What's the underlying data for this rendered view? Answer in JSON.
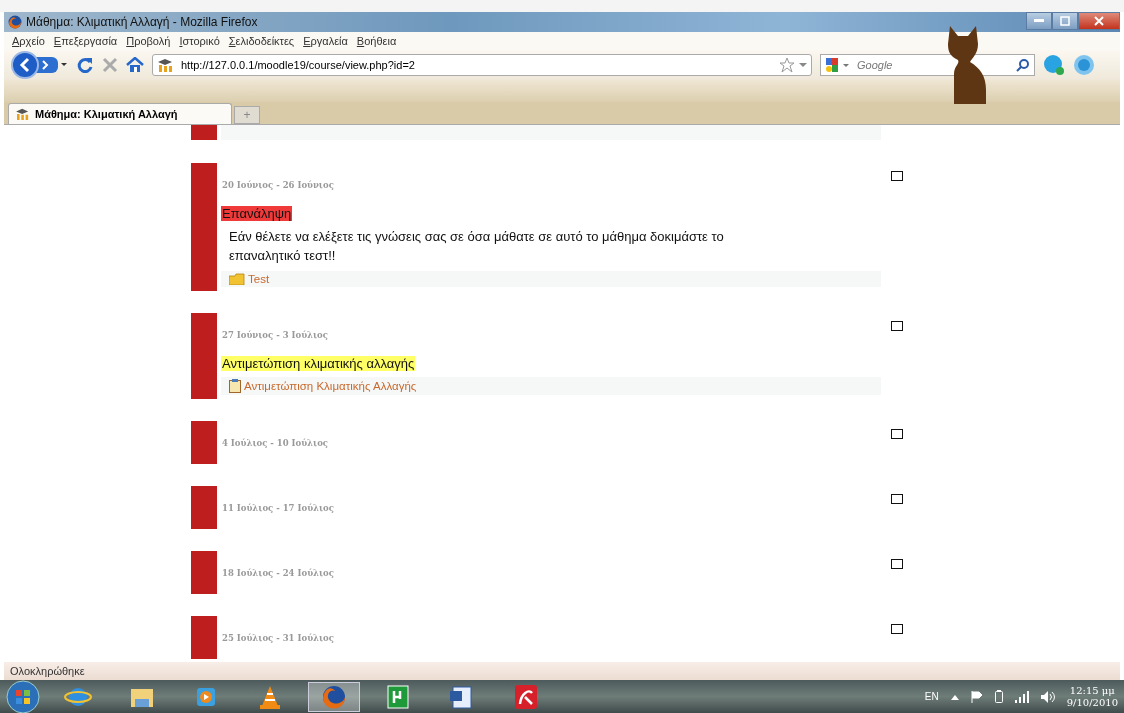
{
  "window": {
    "title": "Μάθημα: Κλιματική Αλλαγή - Mozilla Firefox"
  },
  "menu": [
    "Αρχείο",
    "Επεξεργασία",
    "Προβολή",
    "Ιστορικό",
    "Σελιδοδείκτες",
    "Εργαλεία",
    "Βοήθεια"
  ],
  "address_bar": {
    "value": "http://127.0.0.1/moodle19/course/view.php?id=2"
  },
  "search": {
    "placeholder": "Google"
  },
  "tabs": [
    {
      "label": "Μάθημα: Κλιματική Αλλαγή",
      "selected": true
    }
  ],
  "new_tab": {
    "label": "+"
  },
  "sections": [
    {
      "dates": "20 Ιούνιος - 26 Ιούνιος",
      "highlight_checked": false,
      "items": [
        {
          "kind": "heading",
          "text": "Επανάληψη",
          "color": "#f03a3a"
        },
        {
          "kind": "summary",
          "text": "Εάν θέλετε να ελέξετε τις γνώσεις σας σε όσα μάθατε σε αυτό το μάθημα δοκιμάστε το επαναλητικό τεστ!!"
        },
        {
          "kind": "quiz-link",
          "text": "Test"
        }
      ]
    },
    {
      "dates": "27 Ιούνιος - 3 Ιούλιος",
      "highlight_checked": false,
      "items": [
        {
          "kind": "heading",
          "text": "Αντιμετώπιση κλιματικής αλλαγής",
          "color": "#ffff66"
        },
        {
          "kind": "page-link",
          "text": "Αντιμετώπιση Κλιματικής Αλλαγής"
        }
      ]
    },
    {
      "dates": "4 Ιούλιος - 10 Ιούλιος",
      "highlight_checked": false
    },
    {
      "dates": "11 Ιούλιος - 17 Ιούλιος",
      "highlight_checked": false
    },
    {
      "dates": "18 Ιούλιος - 24 Ιούλιος",
      "highlight_checked": false
    },
    {
      "dates": "25 Ιούλιος - 31 Ιούλιος",
      "highlight_checked": false
    }
  ],
  "status_bar": {
    "text": "Ολοκληρώθηκε"
  },
  "taskbar": {
    "buttons": [
      {
        "selected": false
      },
      {
        "selected": false
      },
      {
        "selected": false
      },
      {
        "selected": false
      },
      {
        "selected": true
      },
      {
        "selected": false
      },
      {
        "selected": false
      },
      {
        "selected": false
      }
    ],
    "language": "EN",
    "time": "12:15 μμ",
    "date": "9/10/2010"
  }
}
